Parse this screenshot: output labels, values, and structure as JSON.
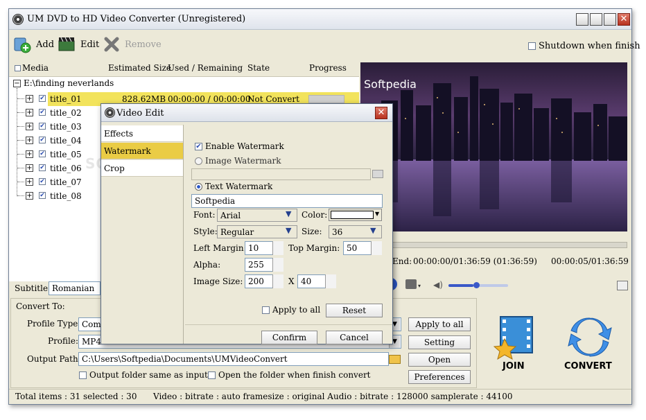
{
  "window": {
    "title": "UM DVD to HD Video Converter  (Unregistered)"
  },
  "toolbar": {
    "add": "Add",
    "edit": "Edit",
    "remove": "Remove",
    "shutdown": "Shutdown when finish"
  },
  "list": {
    "headers": {
      "media": "Media",
      "size": "Estimated Size",
      "used": "Used / Remaining",
      "state": "State",
      "progress": "Progress"
    },
    "root": "E:\\finding neverlands",
    "rows": [
      {
        "name": "title_01",
        "size": "828.62MB",
        "used": "00:00:00 / 00:00:00",
        "state": "Not Convert"
      },
      {
        "name": "title_02"
      },
      {
        "name": "title_03"
      },
      {
        "name": "title_04"
      },
      {
        "name": "title_05"
      },
      {
        "name": "title_06"
      },
      {
        "name": "title_07"
      },
      {
        "name": "title_08"
      }
    ]
  },
  "preview": {
    "watermark": "Softpedia",
    "end_label": "End:",
    "end_time": "00:00:00/01:36:59 (01:36:59)",
    "pos_time": "00:00:05/01:36:59",
    "volume": 0.42
  },
  "subtitle": {
    "label": "Subtitle:",
    "value": "Romanian"
  },
  "convert": {
    "section": "Convert To:",
    "profile_type_label": "Profile Type:",
    "profile_type_value": "Com",
    "profile_label": "Profile:",
    "profile_value": "MP4",
    "output_label": "Output Path:",
    "output_value": "C:\\Users\\Softpedia\\Documents\\UMVideoConvert",
    "same_as_input": "Output folder same as input",
    "open_when_finish": "Open the folder when finish convert",
    "apply_all": "Apply to all",
    "setting": "Setting",
    "open": "Open",
    "preferences": "Preferences",
    "join": "JOIN",
    "convert": "CONVERT"
  },
  "status": {
    "left": "Total items : 31   selected : 30",
    "right": "Video : bitrate : auto framesize : original   Audio : bitrate : 128000 samplerate : 44100"
  },
  "dialog": {
    "title": "Video Edit",
    "tabs": [
      "Effects",
      "Watermark",
      "Crop"
    ],
    "enable_watermark": "Enable Watermark",
    "image_watermark": "Image Watermark",
    "text_watermark": "Text Watermark",
    "text_value": "Softpedia",
    "font_label": "Font:",
    "font_value": "Arial",
    "color_label": "Color:",
    "style_label": "Style:",
    "style_value": "Regular",
    "size_label": "Size:",
    "size_value": "36",
    "left_margin_label": "Left Margin:",
    "left_margin_value": "10",
    "top_margin_label": "Top Margin:",
    "top_margin_value": "50",
    "alpha_label": "Alpha:",
    "alpha_value": "255",
    "image_size_label": "Image Size:",
    "image_w": "200",
    "x": "X",
    "image_h": "40",
    "apply_all": "Apply to all",
    "reset": "Reset",
    "confirm": "Confirm",
    "cancel": "Cancel"
  }
}
